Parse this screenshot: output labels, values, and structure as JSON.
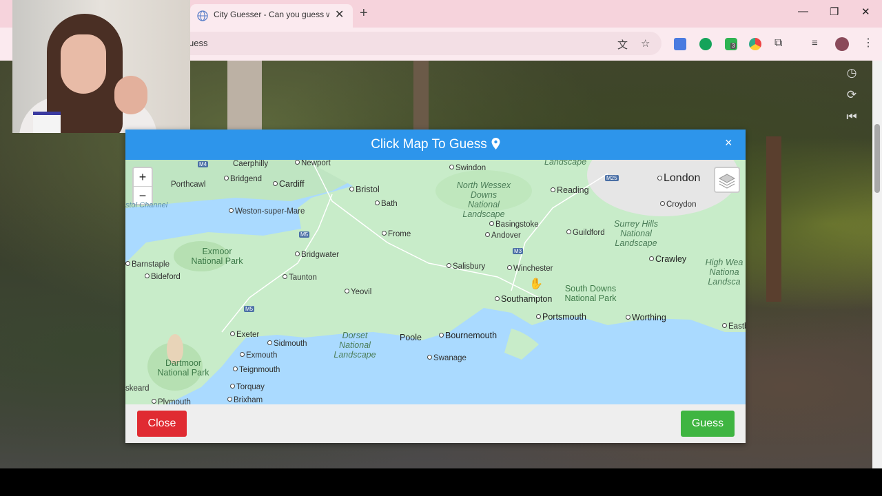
{
  "browser": {
    "tab_title": "City Guesser - Can you guess w",
    "url_fragment": "uess",
    "extension_badge": "3"
  },
  "modal": {
    "title": "Click Map To Guess",
    "close_x": "×",
    "close_label": "Close",
    "guess_label": "Guess",
    "header_color": "#2d95eb"
  },
  "map": {
    "zoom_in": "+",
    "zoom_out": "−",
    "big_cities": [
      "London"
    ],
    "cities": [
      "Newport",
      "Cardiff",
      "Bristol",
      "Bath",
      "Swindon",
      "Reading",
      "Croydon",
      "Basingstoke",
      "Andover",
      "Guildford",
      "Frome",
      "Bridgwater",
      "Taunton",
      "Yeovil",
      "Salisbury",
      "Winchester",
      "Southampton",
      "Portsmouth",
      "Worthing",
      "Crawley",
      "Eastbou",
      "Bournemouth",
      "Poole",
      "Swanage",
      "Exeter",
      "Sidmouth",
      "Exmouth",
      "Teignmouth",
      "Torquay",
      "Brixham",
      "Plymouth",
      "Bideford",
      "Barnstaple",
      "Bridgend",
      "Weston-super-Mare"
    ],
    "plain_labels": [
      "Caerphilly",
      "Porthcawl",
      "skeard"
    ],
    "parks": [
      "Exmoor National Park",
      "Dartmoor National Park",
      "South Downs National Park"
    ],
    "landscapes": [
      "North Wessex Downs National Landscape",
      "Surrey Hills National Landscape",
      "Dorset National Landscape",
      "High Wea Nationa Landsca",
      "Landscape"
    ],
    "sea": "stol Channel",
    "roads": [
      "M4",
      "M5",
      "M5",
      "M3",
      "M25"
    ]
  }
}
